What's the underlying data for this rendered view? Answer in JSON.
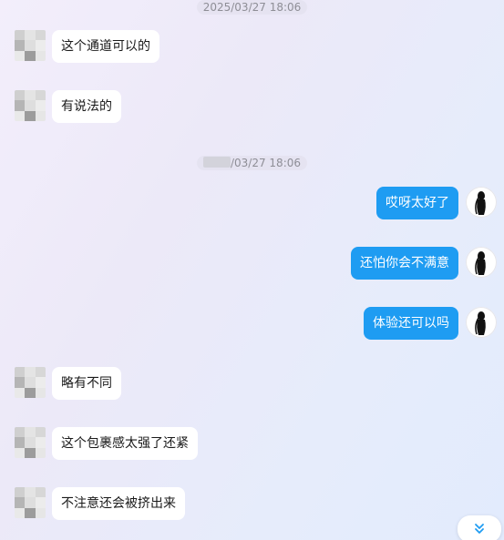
{
  "chat": {
    "timestamps": [
      {
        "text": "2025/03/27 18:06"
      },
      {
        "masked_prefix": true,
        "text": "/03/27 18:06"
      }
    ],
    "messages": [
      {
        "side": "in",
        "text": "这个通道可以的"
      },
      {
        "side": "in",
        "text": "有说法的"
      },
      {
        "side": "out",
        "text": "哎呀太好了"
      },
      {
        "side": "out",
        "text": "还怕你会不满意"
      },
      {
        "side": "out",
        "text": "体验还可以吗"
      },
      {
        "side": "in",
        "text": "略有不同"
      },
      {
        "side": "in",
        "text": "这个包裹感太强了还紧"
      },
      {
        "side": "in",
        "text": "不注意还会被挤出来"
      }
    ]
  },
  "colors": {
    "outgoing_bubble": "#1e9cf2",
    "incoming_bubble": "#ffffff",
    "scroll_icon": "#1e9cf2"
  },
  "icons": {
    "incoming_avatar": "pixelated-avatar-icon",
    "outgoing_avatar": "silhouette-avatar-icon",
    "scroll_down": "double-chevron-down-icon"
  }
}
